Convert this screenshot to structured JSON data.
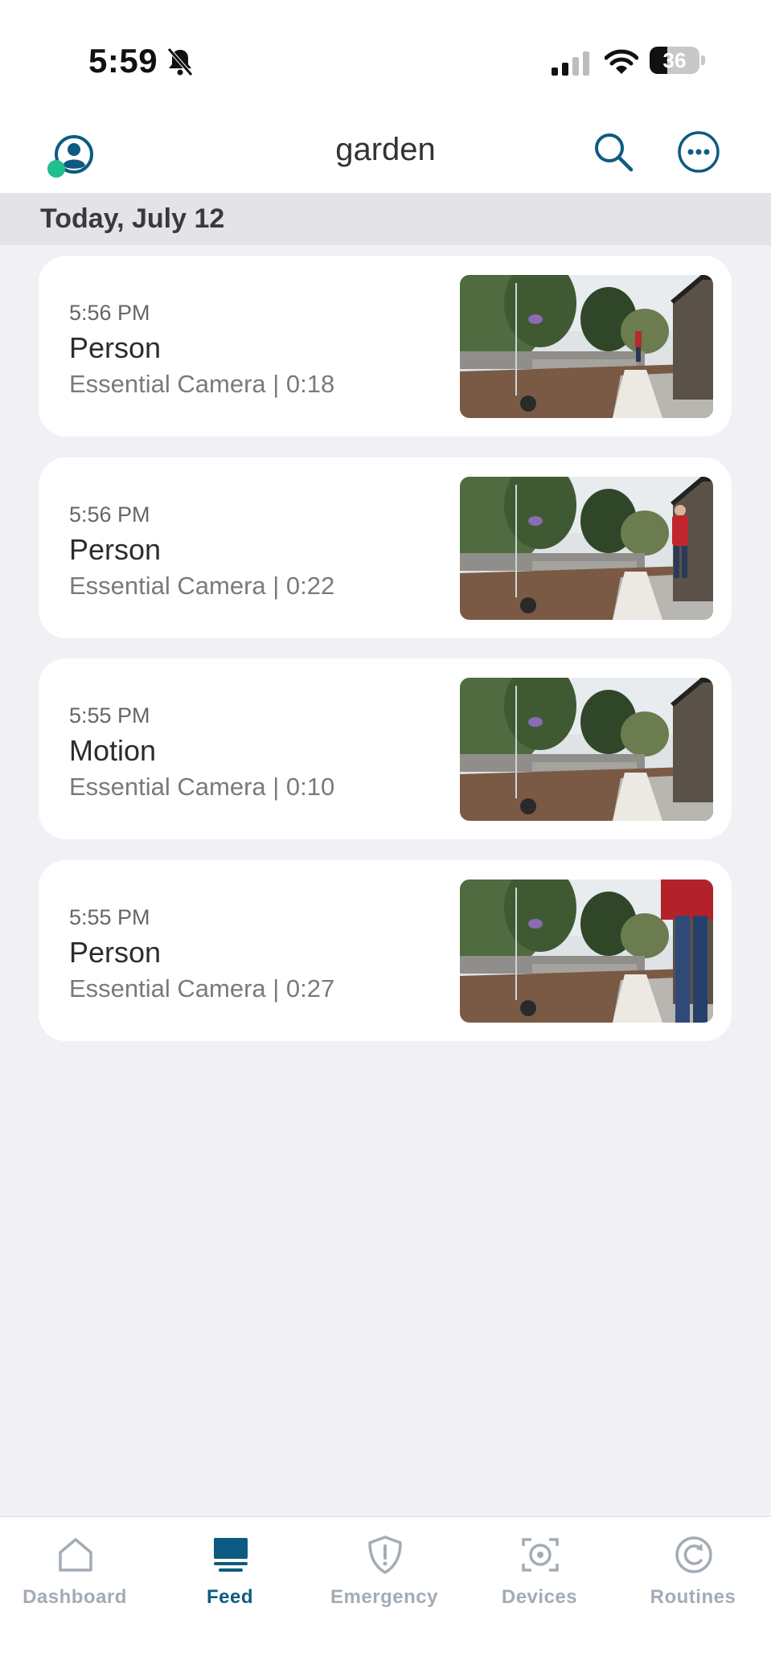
{
  "status_bar": {
    "time": "5:59",
    "battery": "36",
    "battery_level": 0.36
  },
  "header": {
    "title": "garden"
  },
  "feed": {
    "date_label": "Today, July 12",
    "events": [
      {
        "time": "5:56 PM",
        "type": "Person",
        "subtitle": "Essential Camera | 0:18"
      },
      {
        "time": "5:56 PM",
        "type": "Person",
        "subtitle": "Essential Camera | 0:22"
      },
      {
        "time": "5:55 PM",
        "type": "Motion",
        "subtitle": "Essential Camera | 0:10"
      },
      {
        "time": "5:55 PM",
        "type": "Person",
        "subtitle": "Essential Camera | 0:27"
      }
    ]
  },
  "tabs": [
    {
      "label": "Dashboard",
      "icon": "house-icon",
      "active": false
    },
    {
      "label": "Feed",
      "icon": "feed-icon",
      "active": true
    },
    {
      "label": "Emergency",
      "icon": "shield-alert-icon",
      "active": false
    },
    {
      "label": "Devices",
      "icon": "camera-icon",
      "active": false
    },
    {
      "label": "Routines",
      "icon": "routine-icon",
      "active": false
    }
  ],
  "colors": {
    "accent": "#0d5b82",
    "presence": "#1fbf8f",
    "inactive_tab": "#a3acb5"
  }
}
